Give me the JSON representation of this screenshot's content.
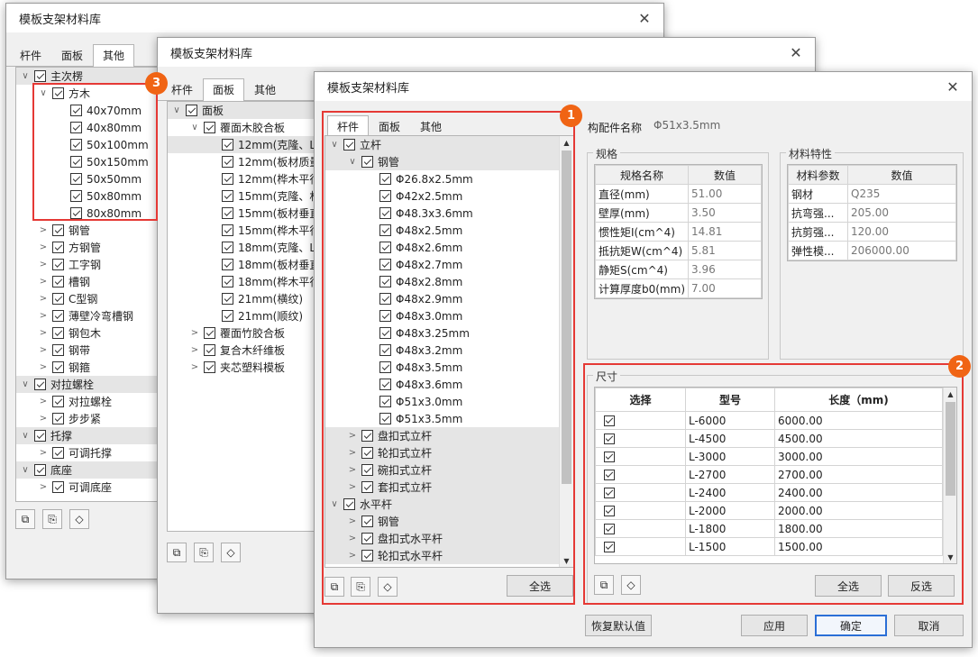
{
  "win1": {
    "title": "模板支架材料库",
    "tabs": [
      "杆件",
      "面板",
      "其他"
    ],
    "tree": [
      {
        "label": "主次楞",
        "arrow": "∨",
        "level": 0,
        "sel": true
      },
      {
        "label": "方木",
        "arrow": "∨",
        "level": 1
      },
      {
        "label": "40x70mm",
        "arrow": "",
        "level": 2
      },
      {
        "label": "40x80mm",
        "arrow": "",
        "level": 2
      },
      {
        "label": "50x100mm",
        "arrow": "",
        "level": 2
      },
      {
        "label": "50x150mm",
        "arrow": "",
        "level": 2
      },
      {
        "label": "50x50mm",
        "arrow": "",
        "level": 2
      },
      {
        "label": "50x80mm",
        "arrow": "",
        "level": 2
      },
      {
        "label": "80x80mm",
        "arrow": "",
        "level": 2
      },
      {
        "label": "钢管",
        "arrow": ">",
        "level": 1
      },
      {
        "label": "方钢管",
        "arrow": ">",
        "level": 1
      },
      {
        "label": "工字钢",
        "arrow": ">",
        "level": 1
      },
      {
        "label": "槽钢",
        "arrow": ">",
        "level": 1
      },
      {
        "label": "C型钢",
        "arrow": ">",
        "level": 1
      },
      {
        "label": "薄壁冷弯槽钢",
        "arrow": ">",
        "level": 1
      },
      {
        "label": "钢包木",
        "arrow": ">",
        "level": 1
      },
      {
        "label": "钢带",
        "arrow": ">",
        "level": 1
      },
      {
        "label": "钢箍",
        "arrow": ">",
        "level": 1
      },
      {
        "label": "对拉螺栓",
        "arrow": "∨",
        "level": 0,
        "sel": true
      },
      {
        "label": "对拉螺栓",
        "arrow": ">",
        "level": 1
      },
      {
        "label": "步步紧",
        "arrow": ">",
        "level": 1
      },
      {
        "label": "托撑",
        "arrow": "∨",
        "level": 0,
        "sel": true
      },
      {
        "label": "可调托撑",
        "arrow": ">",
        "level": 1
      },
      {
        "label": "底座",
        "arrow": "∨",
        "level": 0,
        "sel": true
      },
      {
        "label": "可调底座",
        "arrow": ">",
        "level": 1
      }
    ]
  },
  "win2": {
    "title": "模板支架材料库",
    "tabs": [
      "杆件",
      "面板",
      "其他"
    ],
    "tree": [
      {
        "label": "面板",
        "arrow": "∨",
        "level": 0,
        "sel": true
      },
      {
        "label": "覆面木胶合板",
        "arrow": "∨",
        "level": 1
      },
      {
        "label": "12mm(克隆、L",
        "arrow": "",
        "level": 2,
        "sel": true
      },
      {
        "label": "12mm(板材质量",
        "arrow": "",
        "level": 2
      },
      {
        "label": "12mm(桦木平行",
        "arrow": "",
        "level": 2
      },
      {
        "label": "15mm(克隆、杉",
        "arrow": "",
        "level": 2
      },
      {
        "label": "15mm(板材垂直",
        "arrow": "",
        "level": 2
      },
      {
        "label": "15mm(桦木平行",
        "arrow": "",
        "level": 2
      },
      {
        "label": "18mm(克隆、L",
        "arrow": "",
        "level": 2
      },
      {
        "label": "18mm(板材垂直",
        "arrow": "",
        "level": 2
      },
      {
        "label": "18mm(桦木平行",
        "arrow": "",
        "level": 2
      },
      {
        "label": "21mm(横纹)",
        "arrow": "",
        "level": 2
      },
      {
        "label": "21mm(顺纹)",
        "arrow": "",
        "level": 2
      },
      {
        "label": "覆面竹胶合板",
        "arrow": ">",
        "level": 1
      },
      {
        "label": "复合木纤维板",
        "arrow": ">",
        "level": 1
      },
      {
        "label": "夹芯塑料模板",
        "arrow": ">",
        "level": 1
      }
    ]
  },
  "win3": {
    "title": "模板支架材料库",
    "tabs": [
      "杆件",
      "面板",
      "其他"
    ],
    "tree": [
      {
        "label": "立杆",
        "arrow": "∨",
        "level": 0,
        "sel": true
      },
      {
        "label": "钢管",
        "arrow": "∨",
        "level": 1,
        "sel": true
      },
      {
        "label": "Φ26.8x2.5mm",
        "arrow": "",
        "level": 2
      },
      {
        "label": "Φ42x2.5mm",
        "arrow": "",
        "level": 2
      },
      {
        "label": "Φ48.3x3.6mm",
        "arrow": "",
        "level": 2
      },
      {
        "label": "Φ48x2.5mm",
        "arrow": "",
        "level": 2
      },
      {
        "label": "Φ48x2.6mm",
        "arrow": "",
        "level": 2
      },
      {
        "label": "Φ48x2.7mm",
        "arrow": "",
        "level": 2
      },
      {
        "label": "Φ48x2.8mm",
        "arrow": "",
        "level": 2
      },
      {
        "label": "Φ48x2.9mm",
        "arrow": "",
        "level": 2
      },
      {
        "label": "Φ48x3.0mm",
        "arrow": "",
        "level": 2
      },
      {
        "label": "Φ48x3.25mm",
        "arrow": "",
        "level": 2
      },
      {
        "label": "Φ48x3.2mm",
        "arrow": "",
        "level": 2
      },
      {
        "label": "Φ48x3.5mm",
        "arrow": "",
        "level": 2
      },
      {
        "label": "Φ48x3.6mm",
        "arrow": "",
        "level": 2
      },
      {
        "label": "Φ51x3.0mm",
        "arrow": "",
        "level": 2
      },
      {
        "label": "Φ51x3.5mm",
        "arrow": "",
        "level": 2
      },
      {
        "label": "盘扣式立杆",
        "arrow": ">",
        "level": 1,
        "sel": true
      },
      {
        "label": "轮扣式立杆",
        "arrow": ">",
        "level": 1,
        "sel": true
      },
      {
        "label": "碗扣式立杆",
        "arrow": ">",
        "level": 1,
        "sel": true
      },
      {
        "label": "套扣式立杆",
        "arrow": ">",
        "level": 1,
        "sel": true
      },
      {
        "label": "水平杆",
        "arrow": "∨",
        "level": 0,
        "sel": true
      },
      {
        "label": "钢管",
        "arrow": ">",
        "level": 1,
        "sel": true
      },
      {
        "label": "盘扣式水平杆",
        "arrow": ">",
        "level": 1,
        "sel": true
      },
      {
        "label": "轮扣式水平杆",
        "arrow": ">",
        "level": 1,
        "sel": true
      }
    ],
    "select_all": "全选",
    "component_label": "构配件名称",
    "component_value": "Φ51x3.5mm",
    "spec": {
      "title": "规格",
      "headers": [
        "规格名称",
        "数值"
      ],
      "rows": [
        [
          "直径(mm)",
          "51.00"
        ],
        [
          "壁厚(mm)",
          "3.50"
        ],
        [
          "惯性矩I(cm^4)",
          "14.81"
        ],
        [
          "抵抗矩W(cm^4)",
          "5.81"
        ],
        [
          "静矩S(cm^4)",
          "3.96"
        ],
        [
          "计算厚度b0(mm)",
          "7.00"
        ]
      ]
    },
    "material": {
      "title": "材料特性",
      "headers": [
        "材料参数",
        "数值"
      ],
      "rows": [
        [
          "钢材",
          "Q235"
        ],
        [
          "抗弯强...",
          "205.00"
        ],
        [
          "抗剪强...",
          "120.00"
        ],
        [
          "弹性模...",
          "206000.00"
        ]
      ]
    },
    "size": {
      "title": "尺寸",
      "headers": [
        "选择",
        "型号",
        "长度（mm)"
      ],
      "rows": [
        [
          "L-6000",
          "6000.00"
        ],
        [
          "L-4500",
          "4500.00"
        ],
        [
          "L-3000",
          "3000.00"
        ],
        [
          "L-2700",
          "2700.00"
        ],
        [
          "L-2400",
          "2400.00"
        ],
        [
          "L-2000",
          "2000.00"
        ],
        [
          "L-1800",
          "1800.00"
        ],
        [
          "L-1500",
          "1500.00"
        ]
      ],
      "select_all": "全选",
      "invert": "反选"
    },
    "restore": "恢复默认值",
    "apply": "应用",
    "ok": "确定",
    "cancel": "取消"
  },
  "badges": [
    "1",
    "2",
    "3"
  ],
  "colors": {
    "badge": "#f06414",
    "highlight": "#e53935",
    "primary": "#2b6fd6"
  }
}
